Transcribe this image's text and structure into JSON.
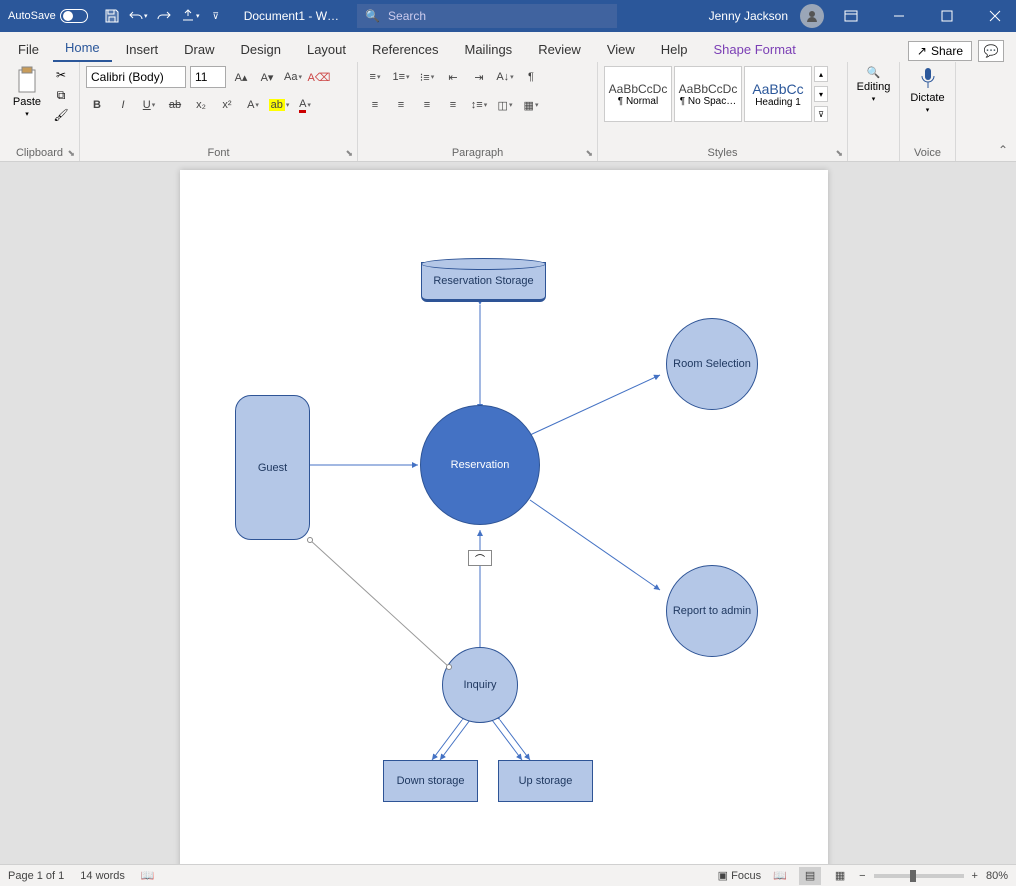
{
  "titlebar": {
    "autosave": "AutoSave",
    "doctitle": "Document1 - W…",
    "search_placeholder": "Search",
    "user": "Jenny Jackson"
  },
  "menu": {
    "file": "File",
    "home": "Home",
    "insert": "Insert",
    "draw": "Draw",
    "design": "Design",
    "layout": "Layout",
    "references": "References",
    "mailings": "Mailings",
    "review": "Review",
    "view": "View",
    "help": "Help",
    "shapefmt": "Shape Format",
    "share": "Share"
  },
  "ribbon": {
    "clipboard": {
      "label": "Clipboard",
      "paste": "Paste"
    },
    "font": {
      "label": "Font",
      "name": "Calibri (Body)",
      "size": "11"
    },
    "paragraph": {
      "label": "Paragraph"
    },
    "styles": {
      "label": "Styles",
      "normal_prev": "AaBbCcDc",
      "normal_name": "¶ Normal",
      "nospac_prev": "AaBbCcDc",
      "nospac_name": "¶ No Spac…",
      "h1_prev": "AaBbCc",
      "h1_name": "Heading 1"
    },
    "editing": {
      "label": "Editing"
    },
    "voice": {
      "label": "Voice",
      "dictate": "Dictate"
    }
  },
  "diagram": {
    "resv_storage": "Reservation Storage",
    "guest": "Guest",
    "reservation": "Reservation",
    "room_sel": "Room Selection",
    "report": "Report to admin",
    "inquiry": "Inquiry",
    "down_storage": "Down storage",
    "up_storage": "Up storage"
  },
  "status": {
    "page": "Page 1 of 1",
    "words": "14 words",
    "focus": "Focus",
    "zoom": "80%"
  }
}
